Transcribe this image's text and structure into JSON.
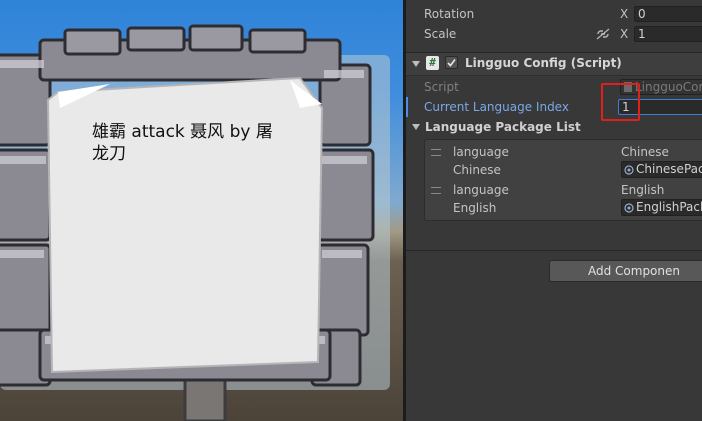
{
  "game_view": {
    "sign_text": "雄霸 attack 聂风 by 屠龙刀"
  },
  "inspector": {
    "transform": {
      "rotation_label": "Rotation",
      "scale_label": "Scale",
      "x_axis": "X",
      "rotation_x_value": "0",
      "scale_x_value": "1",
      "scale_link_icon": "link-icon"
    },
    "component": {
      "title": "Lingguo Config (Script)",
      "enabled": true,
      "script_label": "Script",
      "script_value": "LingguoCon",
      "current_language_label": "Current Language Index",
      "current_language_value": "1",
      "list_title": "Language Package List",
      "items": [
        {
          "field_label": "language",
          "field_value": "Chinese",
          "object_label": "Chinese",
          "object_value": "ChinesePac"
        },
        {
          "field_label": "language",
          "field_value": "English",
          "object_label": "English",
          "object_value": "EnglishPack"
        }
      ]
    },
    "add_component_label": "Add Componen"
  },
  "colors": {
    "highlight_border": "#e0201a",
    "modified_label": "#79a8e8",
    "inspector_bg": "#383838"
  }
}
